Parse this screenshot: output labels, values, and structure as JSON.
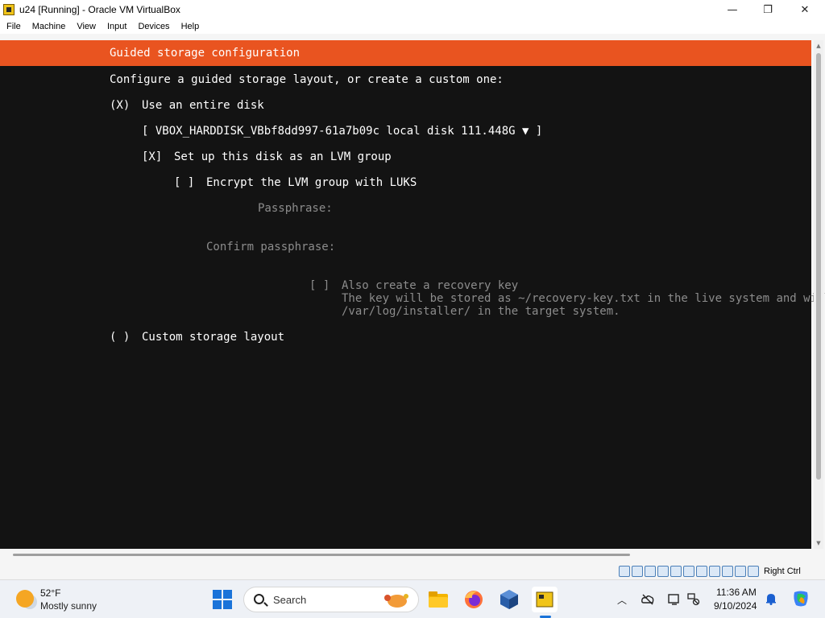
{
  "window": {
    "title": "u24 [Running] - Oracle VM VirtualBox",
    "minimize": "—",
    "maximize": "❐",
    "close": "✕"
  },
  "menu": [
    "File",
    "Machine",
    "View",
    "Input",
    "Devices",
    "Help"
  ],
  "installer": {
    "header": "Guided storage configuration",
    "intro": "Configure a guided storage layout, or create a custom one:",
    "entire_disk_radio": "(X)",
    "entire_disk_label": "Use an entire disk",
    "disk_select": "[ VBOX_HARDDISK_VBbf8dd997-61a7b09c local disk 111.448G ▼ ]",
    "lvm_checkbox": "[X]",
    "lvm_label": "Set up this disk as an LVM group",
    "luks_checkbox": "[ ]",
    "luks_label": "Encrypt the LVM group with LUKS",
    "passphrase_label": "Passphrase:",
    "passphrase_value": "",
    "confirm_label": "Confirm passphrase:",
    "confirm_value": "",
    "recovery_checkbox": "[ ]",
    "recovery_label": "Also create a recovery key",
    "recovery_desc_1": "The key will be stored as ~/recovery-key.txt in the live system and will",
    "recovery_desc_2": "/var/log/installer/ in the target system.",
    "custom_radio": "( )",
    "custom_label": "Custom storage layout",
    "accent_color": "#E95420"
  },
  "status_bar": {
    "host_key": "Right Ctrl",
    "icons": [
      "hard-disk-icon",
      "optical-drive-icon",
      "audio-icon",
      "network-icon",
      "usb-icon",
      "shared-folder-icon",
      "display-icon",
      "recording-icon",
      "cpu-icon",
      "mouse-integration-icon",
      "keyboard-icon"
    ]
  },
  "taskbar": {
    "weather_temp": "52°F",
    "weather_desc": "Mostly sunny",
    "search_placeholder": "Search",
    "time": "11:36 AM",
    "date": "9/10/2024",
    "apps": [
      "start-icon",
      "file-explorer-icon",
      "firefox-icon",
      "virtualbox-icon",
      "virtualbox-vm-icon"
    ],
    "tray": [
      "chevron-up-icon",
      "cloud-off-icon",
      "display-settings-icon",
      "network-icon",
      "notification-bell-icon",
      "copilot-icon"
    ]
  }
}
